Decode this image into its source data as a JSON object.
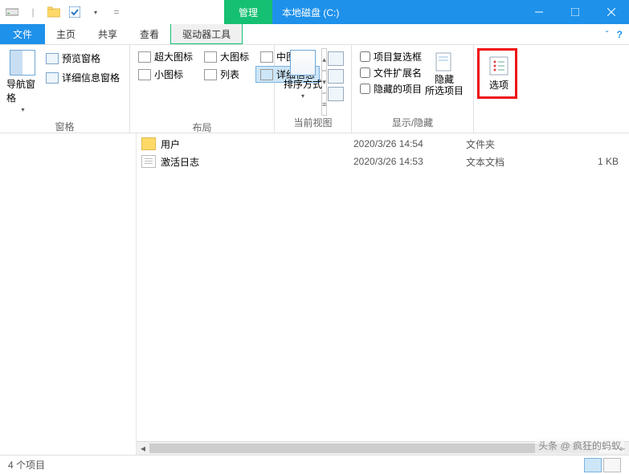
{
  "title": "本地磁盘 (C:)",
  "context_tab": "管理",
  "tabs": {
    "file": "文件",
    "home": "主页",
    "share": "共享",
    "view": "查看",
    "drive_tools": "驱动器工具"
  },
  "ribbon": {
    "panes": {
      "label": "窗格",
      "nav": "导航窗格",
      "preview": "预览窗格",
      "details": "详细信息窗格"
    },
    "layout": {
      "label": "布局",
      "extra_large": "超大图标",
      "large": "大图标",
      "medium": "中图标",
      "small": "小图标",
      "list": "列表",
      "details": "详细信息"
    },
    "current_view": {
      "label": "当前视图",
      "sort": "排序方式"
    },
    "show_hide": {
      "label": "显示/隐藏",
      "checkboxes": "项目复选框",
      "extensions": "文件扩展名",
      "hidden": "隐藏的项目",
      "hide_selected": "隐藏\n所选项目"
    },
    "options": "选项"
  },
  "files": [
    {
      "name": "用户",
      "date": "2020/3/26 14:54",
      "type": "文件夹",
      "size": ""
    },
    {
      "name": "激活日志",
      "date": "2020/3/26 14:53",
      "type": "文本文档",
      "size": "1 KB"
    }
  ],
  "status": "4 个项目",
  "watermark": "头条 @ 疯狂的蚂蚁"
}
